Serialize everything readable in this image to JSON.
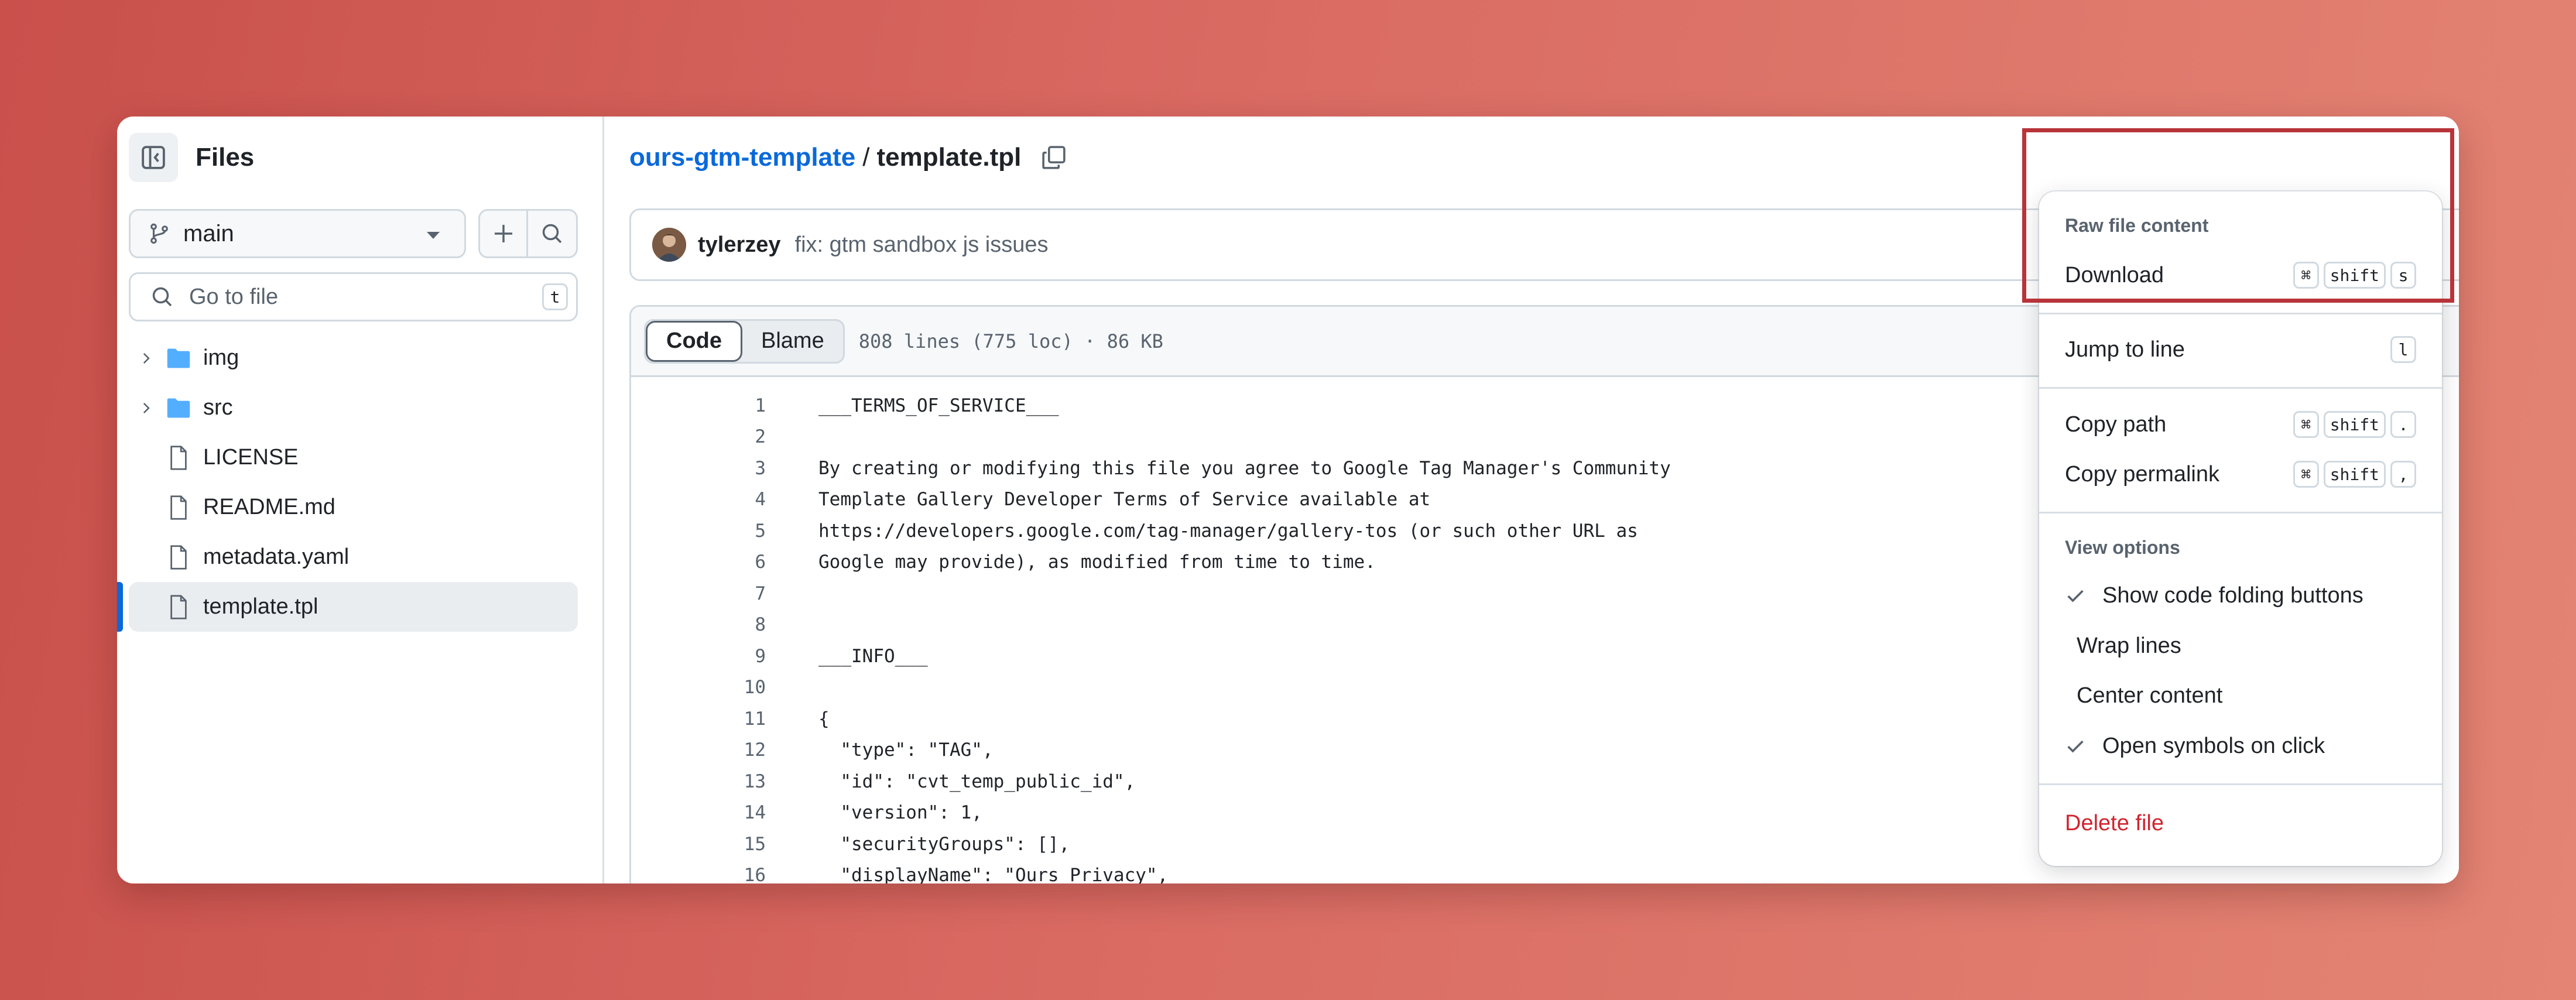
{
  "sidebar": {
    "title": "Files",
    "branch": "main",
    "search_placeholder": "Go to file",
    "search_shortcut": "t",
    "tree": [
      {
        "name": "img",
        "type": "folder"
      },
      {
        "name": "src",
        "type": "folder"
      },
      {
        "name": "LICENSE",
        "type": "file"
      },
      {
        "name": "README.md",
        "type": "file"
      },
      {
        "name": "metadata.yaml",
        "type": "file"
      },
      {
        "name": "template.tpl",
        "type": "file",
        "active": true
      }
    ]
  },
  "breadcrumb": {
    "repo": "ours-gtm-template",
    "separator": "/",
    "file": "template.tpl"
  },
  "commit": {
    "author": "tylerzey",
    "message": "fix: gtm sandbox js issues"
  },
  "code": {
    "tabs": [
      "Code",
      "Blame"
    ],
    "active_tab": "Code",
    "meta": "808 lines (775 loc) · 86 KB",
    "lines": [
      {
        "n": "1",
        "t": "___TERMS_OF_SERVICE___"
      },
      {
        "n": "2",
        "t": ""
      },
      {
        "n": "3",
        "t": "By creating or modifying this file you agree to Google Tag Manager's Community"
      },
      {
        "n": "4",
        "t": "Template Gallery Developer Terms of Service available at"
      },
      {
        "n": "5",
        "t": "https://developers.google.com/tag-manager/gallery-tos (or such other URL as"
      },
      {
        "n": "6",
        "t": "Google may provide), as modified from time to time."
      },
      {
        "n": "7",
        "t": ""
      },
      {
        "n": "8",
        "t": ""
      },
      {
        "n": "9",
        "t": "___INFO___"
      },
      {
        "n": "10",
        "t": ""
      },
      {
        "n": "11",
        "t": "{"
      },
      {
        "n": "12",
        "t": "  \"type\": \"TAG\","
      },
      {
        "n": "13",
        "t": "  \"id\": \"cvt_temp_public_id\","
      },
      {
        "n": "14",
        "t": "  \"version\": 1,"
      },
      {
        "n": "15",
        "t": "  \"securityGroups\": [],"
      },
      {
        "n": "16",
        "t": "  \"displayName\": \"Ours Privacy\","
      }
    ]
  },
  "menu": {
    "raw_group": "Raw file content",
    "download": {
      "label": "Download",
      "keys": [
        "⌘",
        "shift",
        "s"
      ]
    },
    "jump": {
      "label": "Jump to line",
      "keys": [
        "l"
      ]
    },
    "copy_path": {
      "label": "Copy path",
      "keys": [
        "⌘",
        "shift",
        "."
      ]
    },
    "copy_permalink": {
      "label": "Copy permalink",
      "keys": [
        "⌘",
        "shift",
        ","
      ]
    },
    "view_group": "View options",
    "show_folding": {
      "label": "Show code folding buttons",
      "checked": true
    },
    "wrap_lines": {
      "label": "Wrap lines",
      "checked": false
    },
    "center_content": {
      "label": "Center content",
      "checked": false
    },
    "open_symbols": {
      "label": "Open symbols on click",
      "checked": true
    },
    "delete": {
      "label": "Delete file"
    }
  },
  "colors": {
    "accent": "#0969da",
    "danger": "#d1242f",
    "highlight": "#b8343a"
  }
}
